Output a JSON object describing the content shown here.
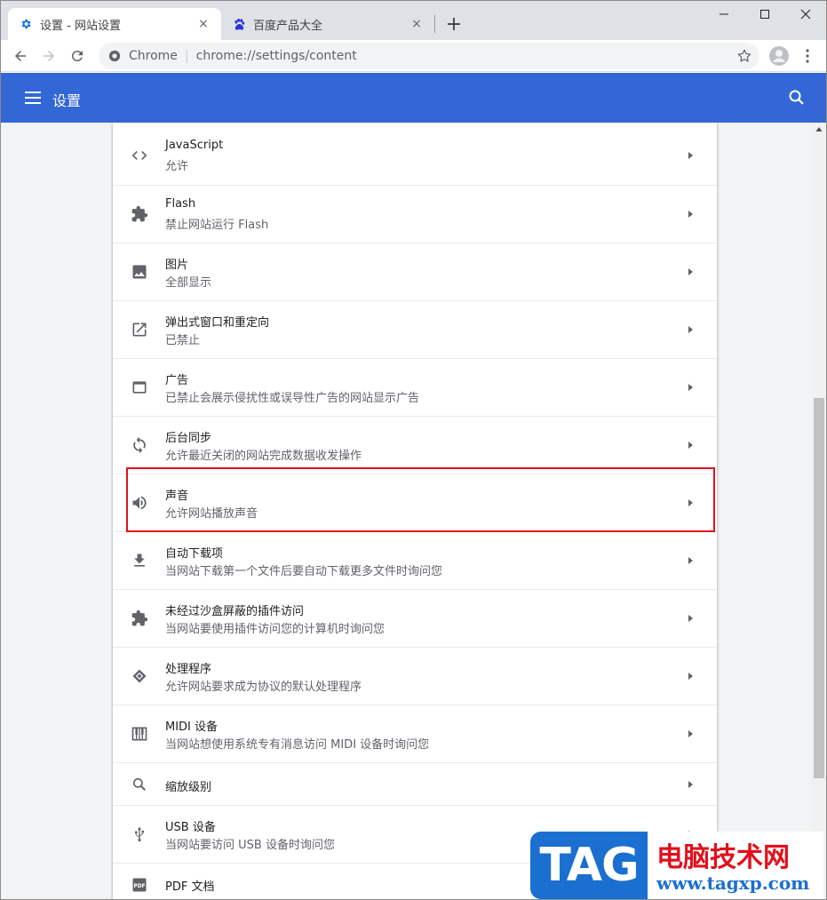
{
  "tabs": [
    {
      "title": "设置 - 网站设置",
      "icon": "gear-icon",
      "close": "×",
      "active": true
    },
    {
      "title": "百度产品大全",
      "icon": "baidu-paw-icon",
      "close": "×",
      "active": false
    }
  ],
  "new_tab_label": "+",
  "toolbar": {
    "omnibox_site": "Chrome",
    "omnibox_sep": "|",
    "omnibox_url": "chrome://settings/content"
  },
  "header": {
    "title": "设置"
  },
  "rows": [
    {
      "title": "JavaScript",
      "subtitle": "允许",
      "icon": "code-icon"
    },
    {
      "title": "Flash",
      "subtitle": "禁止网站运行 Flash",
      "icon": "puzzle-icon"
    },
    {
      "title": "图片",
      "subtitle": "全部显示",
      "icon": "image-icon"
    },
    {
      "title": "弹出式窗口和重定向",
      "subtitle": "已禁止",
      "icon": "open-in-new-icon"
    },
    {
      "title": "广告",
      "subtitle": "已禁止会展示侵扰性或误导性广告的网站显示广告",
      "icon": "web-asset-icon"
    },
    {
      "title": "后台同步",
      "subtitle": "允许最近关闭的网站完成数据收发操作",
      "icon": "sync-icon"
    },
    {
      "title": "声音",
      "subtitle": "允许网站播放声音",
      "icon": "volume-icon"
    },
    {
      "title": "自动下载项",
      "subtitle": "当网站下载第一个文件后要自动下载更多文件时询问您",
      "icon": "download-icon"
    },
    {
      "title": "未经过沙盒屏蔽的插件访问",
      "subtitle": "当网站要使用插件访问您的计算机时询问您",
      "icon": "puzzle-icon"
    },
    {
      "title": "处理程序",
      "subtitle": "允许网站要求成为协议的默认处理程序",
      "icon": "protocol-handler-icon"
    },
    {
      "title": "MIDI 设备",
      "subtitle": "当网站想使用系统专有消息访问 MIDI 设备时询问您",
      "icon": "piano-icon"
    },
    {
      "title": "缩放级别",
      "subtitle": "",
      "icon": "zoom-icon"
    },
    {
      "title": "USB 设备",
      "subtitle": "当网站要访问 USB 设备时询问您",
      "icon": "usb-icon"
    },
    {
      "title": "PDF 文档",
      "subtitle": "",
      "icon": "pdf-icon"
    }
  ],
  "watermark": {
    "logo": "TAG",
    "brand": "电脑技术网",
    "url": "www.tagxp.com"
  },
  "colors": {
    "header_blue": "#3367d6",
    "highlight_red": "#e2101c",
    "watermark_blue": "#1a6fd0"
  }
}
